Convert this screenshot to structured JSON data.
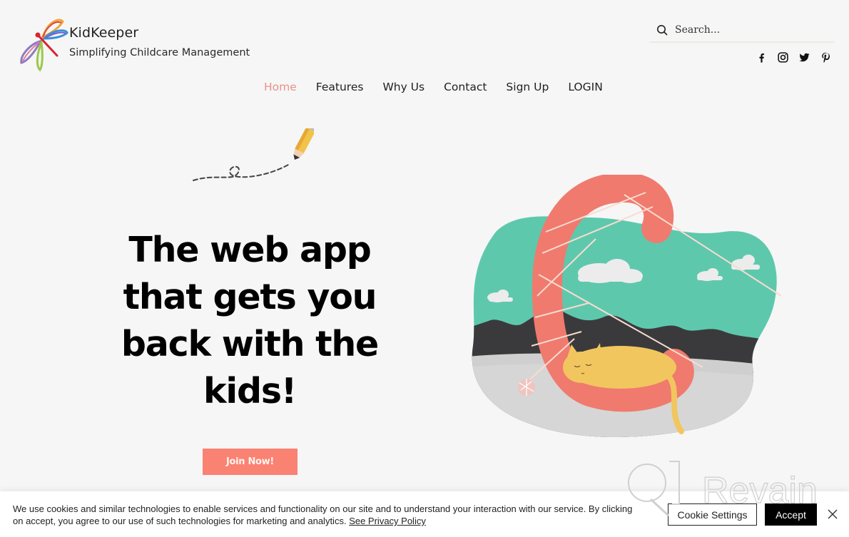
{
  "brand": {
    "title": "KidKeeper",
    "subtitle": "Simplifying Childcare Management",
    "logo_icon": "dragonfly-logo-icon"
  },
  "search": {
    "placeholder": "Search...",
    "value": "",
    "icon": "search-icon"
  },
  "social": [
    {
      "name": "facebook",
      "icon": "facebook-icon"
    },
    {
      "name": "instagram",
      "icon": "instagram-icon"
    },
    {
      "name": "twitter",
      "icon": "twitter-icon"
    },
    {
      "name": "pinterest",
      "icon": "pinterest-icon"
    }
  ],
  "nav": {
    "items": [
      {
        "label": "Home",
        "active": true
      },
      {
        "label": "Features",
        "active": false
      },
      {
        "label": "Why Us",
        "active": false
      },
      {
        "label": "Contact",
        "active": false
      },
      {
        "label": "Sign Up",
        "active": false
      },
      {
        "label": "LOGIN",
        "active": false
      }
    ]
  },
  "hero": {
    "headline": "The web app that gets you back with the kids!",
    "cta_label": "Join Now!",
    "illustration": "sleeping-cat-letter-c-illustration",
    "doodle": "pencil-doodle-icon"
  },
  "cookie": {
    "text_line1": "We use cookies and similar technologies to enable services and functionality on our site and to understand your interaction with our service. By clicking",
    "text_line2": "on accept, you agree to our use of such technologies for marketing and analytics.",
    "policy_link": "See Privacy Policy",
    "settings_label": "Cookie Settings",
    "accept_label": "Accept",
    "close_icon": "close-icon"
  },
  "watermark": {
    "text": "Revain"
  },
  "colors": {
    "accent": "#fa8273",
    "nav_active": "#e8918a",
    "background": "#f6f6f6",
    "teal": "#5ec8ad",
    "dark": "#3a3a3c"
  }
}
